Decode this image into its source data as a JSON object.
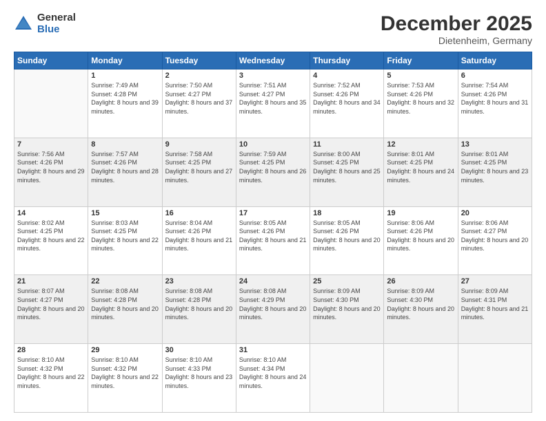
{
  "logo": {
    "general": "General",
    "blue": "Blue"
  },
  "header": {
    "title": "December 2025",
    "subtitle": "Dietenheim, Germany"
  },
  "days_of_week": [
    "Sunday",
    "Monday",
    "Tuesday",
    "Wednesday",
    "Thursday",
    "Friday",
    "Saturday"
  ],
  "weeks": [
    [
      {
        "day": "",
        "sunrise": "",
        "sunset": "",
        "daylight": ""
      },
      {
        "day": "1",
        "sunrise": "Sunrise: 7:49 AM",
        "sunset": "Sunset: 4:28 PM",
        "daylight": "Daylight: 8 hours and 39 minutes."
      },
      {
        "day": "2",
        "sunrise": "Sunrise: 7:50 AM",
        "sunset": "Sunset: 4:27 PM",
        "daylight": "Daylight: 8 hours and 37 minutes."
      },
      {
        "day": "3",
        "sunrise": "Sunrise: 7:51 AM",
        "sunset": "Sunset: 4:27 PM",
        "daylight": "Daylight: 8 hours and 35 minutes."
      },
      {
        "day": "4",
        "sunrise": "Sunrise: 7:52 AM",
        "sunset": "Sunset: 4:26 PM",
        "daylight": "Daylight: 8 hours and 34 minutes."
      },
      {
        "day": "5",
        "sunrise": "Sunrise: 7:53 AM",
        "sunset": "Sunset: 4:26 PM",
        "daylight": "Daylight: 8 hours and 32 minutes."
      },
      {
        "day": "6",
        "sunrise": "Sunrise: 7:54 AM",
        "sunset": "Sunset: 4:26 PM",
        "daylight": "Daylight: 8 hours and 31 minutes."
      }
    ],
    [
      {
        "day": "7",
        "sunrise": "Sunrise: 7:56 AM",
        "sunset": "Sunset: 4:26 PM",
        "daylight": "Daylight: 8 hours and 29 minutes."
      },
      {
        "day": "8",
        "sunrise": "Sunrise: 7:57 AM",
        "sunset": "Sunset: 4:26 PM",
        "daylight": "Daylight: 8 hours and 28 minutes."
      },
      {
        "day": "9",
        "sunrise": "Sunrise: 7:58 AM",
        "sunset": "Sunset: 4:25 PM",
        "daylight": "Daylight: 8 hours and 27 minutes."
      },
      {
        "day": "10",
        "sunrise": "Sunrise: 7:59 AM",
        "sunset": "Sunset: 4:25 PM",
        "daylight": "Daylight: 8 hours and 26 minutes."
      },
      {
        "day": "11",
        "sunrise": "Sunrise: 8:00 AM",
        "sunset": "Sunset: 4:25 PM",
        "daylight": "Daylight: 8 hours and 25 minutes."
      },
      {
        "day": "12",
        "sunrise": "Sunrise: 8:01 AM",
        "sunset": "Sunset: 4:25 PM",
        "daylight": "Daylight: 8 hours and 24 minutes."
      },
      {
        "day": "13",
        "sunrise": "Sunrise: 8:01 AM",
        "sunset": "Sunset: 4:25 PM",
        "daylight": "Daylight: 8 hours and 23 minutes."
      }
    ],
    [
      {
        "day": "14",
        "sunrise": "Sunrise: 8:02 AM",
        "sunset": "Sunset: 4:25 PM",
        "daylight": "Daylight: 8 hours and 22 minutes."
      },
      {
        "day": "15",
        "sunrise": "Sunrise: 8:03 AM",
        "sunset": "Sunset: 4:25 PM",
        "daylight": "Daylight: 8 hours and 22 minutes."
      },
      {
        "day": "16",
        "sunrise": "Sunrise: 8:04 AM",
        "sunset": "Sunset: 4:26 PM",
        "daylight": "Daylight: 8 hours and 21 minutes."
      },
      {
        "day": "17",
        "sunrise": "Sunrise: 8:05 AM",
        "sunset": "Sunset: 4:26 PM",
        "daylight": "Daylight: 8 hours and 21 minutes."
      },
      {
        "day": "18",
        "sunrise": "Sunrise: 8:05 AM",
        "sunset": "Sunset: 4:26 PM",
        "daylight": "Daylight: 8 hours and 20 minutes."
      },
      {
        "day": "19",
        "sunrise": "Sunrise: 8:06 AM",
        "sunset": "Sunset: 4:26 PM",
        "daylight": "Daylight: 8 hours and 20 minutes."
      },
      {
        "day": "20",
        "sunrise": "Sunrise: 8:06 AM",
        "sunset": "Sunset: 4:27 PM",
        "daylight": "Daylight: 8 hours and 20 minutes."
      }
    ],
    [
      {
        "day": "21",
        "sunrise": "Sunrise: 8:07 AM",
        "sunset": "Sunset: 4:27 PM",
        "daylight": "Daylight: 8 hours and 20 minutes."
      },
      {
        "day": "22",
        "sunrise": "Sunrise: 8:08 AM",
        "sunset": "Sunset: 4:28 PM",
        "daylight": "Daylight: 8 hours and 20 minutes."
      },
      {
        "day": "23",
        "sunrise": "Sunrise: 8:08 AM",
        "sunset": "Sunset: 4:28 PM",
        "daylight": "Daylight: 8 hours and 20 minutes."
      },
      {
        "day": "24",
        "sunrise": "Sunrise: 8:08 AM",
        "sunset": "Sunset: 4:29 PM",
        "daylight": "Daylight: 8 hours and 20 minutes."
      },
      {
        "day": "25",
        "sunrise": "Sunrise: 8:09 AM",
        "sunset": "Sunset: 4:30 PM",
        "daylight": "Daylight: 8 hours and 20 minutes."
      },
      {
        "day": "26",
        "sunrise": "Sunrise: 8:09 AM",
        "sunset": "Sunset: 4:30 PM",
        "daylight": "Daylight: 8 hours and 20 minutes."
      },
      {
        "day": "27",
        "sunrise": "Sunrise: 8:09 AM",
        "sunset": "Sunset: 4:31 PM",
        "daylight": "Daylight: 8 hours and 21 minutes."
      }
    ],
    [
      {
        "day": "28",
        "sunrise": "Sunrise: 8:10 AM",
        "sunset": "Sunset: 4:32 PM",
        "daylight": "Daylight: 8 hours and 22 minutes."
      },
      {
        "day": "29",
        "sunrise": "Sunrise: 8:10 AM",
        "sunset": "Sunset: 4:32 PM",
        "daylight": "Daylight: 8 hours and 22 minutes."
      },
      {
        "day": "30",
        "sunrise": "Sunrise: 8:10 AM",
        "sunset": "Sunset: 4:33 PM",
        "daylight": "Daylight: 8 hours and 23 minutes."
      },
      {
        "day": "31",
        "sunrise": "Sunrise: 8:10 AM",
        "sunset": "Sunset: 4:34 PM",
        "daylight": "Daylight: 8 hours and 24 minutes."
      },
      {
        "day": "",
        "sunrise": "",
        "sunset": "",
        "daylight": ""
      },
      {
        "day": "",
        "sunrise": "",
        "sunset": "",
        "daylight": ""
      },
      {
        "day": "",
        "sunrise": "",
        "sunset": "",
        "daylight": ""
      }
    ]
  ]
}
